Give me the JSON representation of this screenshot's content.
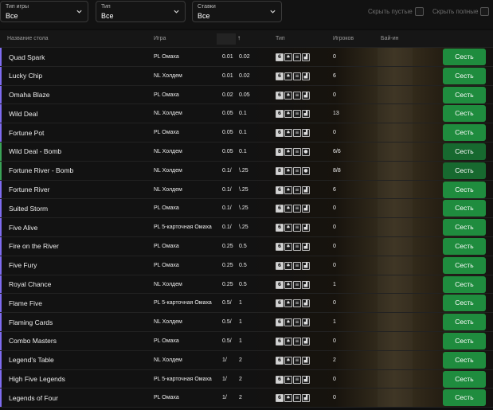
{
  "filters": {
    "game_type": {
      "label": "Тип игры",
      "value": "Все"
    },
    "type": {
      "label": "Тип",
      "value": "Все"
    },
    "stakes": {
      "label": "Ставки",
      "value": "Все"
    },
    "hide_empty": "Скрыть пустые",
    "hide_full": "Скрыть полные"
  },
  "columns": {
    "name": "Название стола",
    "game": "Игра",
    "sort_icon": "↑",
    "type": "Тип",
    "players": "Игроков",
    "buyin": "Бай-ин"
  },
  "colors": {
    "accent_purple": "#7f6cf0",
    "accent_green": "#3aa357",
    "sit_button": "#1f8c3e",
    "sit_button_dark": "#17692f"
  },
  "sit_label": "Сесть",
  "rows": [
    {
      "name": "Quad Spark",
      "game": "PL Омаха",
      "blind1": "0.01",
      "blind2": "0.02",
      "players": "0",
      "accent": "purple",
      "icon4": "chart"
    },
    {
      "name": "Lucky Chip",
      "game": "NL Холдем",
      "blind1": "0.01",
      "blind2": "0.02",
      "players": "6",
      "accent": "purple",
      "icon4": "chart"
    },
    {
      "name": "Omaha Blaze",
      "game": "PL Омаха",
      "blind1": "0.02",
      "blind2": "0.05",
      "players": "0",
      "accent": "purple",
      "icon4": "chart"
    },
    {
      "name": "Wild Deal",
      "game": "NL Холдем",
      "blind1": "0.05",
      "blind2": "0.1",
      "players": "13",
      "accent": "purple",
      "icon4": "chart"
    },
    {
      "name": "Fortune Pot",
      "game": "PL Омаха",
      "blind1": "0.05",
      "blind2": "0.1",
      "players": "0",
      "accent": "purple",
      "icon4": "chart"
    },
    {
      "name": "Wild Deal - Bomb",
      "game": "NL Холдем",
      "blind1": "0.05",
      "blind2": "0.1",
      "players": "6/6",
      "accent": "green",
      "icon4": "bomb"
    },
    {
      "name": "Fortune River - Bomb",
      "game": "NL Холдем",
      "blind1": "0.1/",
      "blind2": "\\.25",
      "players": "8/8",
      "accent": "green",
      "icon4": "bomb"
    },
    {
      "name": "Fortune River",
      "game": "NL Холдем",
      "blind1": "0.1/",
      "blind2": "\\.25",
      "players": "6",
      "accent": "purple",
      "icon4": "chart"
    },
    {
      "name": "Suited Storm",
      "game": "PL Омаха",
      "blind1": "0.1/",
      "blind2": "\\.25",
      "players": "0",
      "accent": "purple",
      "icon4": "chart"
    },
    {
      "name": "Five Alive",
      "game": "PL 5-карточная Омаха",
      "blind1": "0.1/",
      "blind2": "\\.25",
      "players": "0",
      "accent": "purple",
      "icon4": "chart"
    },
    {
      "name": "Fire on the River",
      "game": "PL Омаха",
      "blind1": "0.25",
      "blind2": "0.5",
      "players": "0",
      "accent": "purple",
      "icon4": "chart"
    },
    {
      "name": "Five  Fury",
      "game": "PL Омаха",
      "blind1": "0.25",
      "blind2": "0.5",
      "players": "0",
      "accent": "purple",
      "icon4": "chart"
    },
    {
      "name": "Royal Chance",
      "game": "NL Холдем",
      "blind1": "0.25",
      "blind2": "0.5",
      "players": "1",
      "accent": "purple",
      "icon4": "chart"
    },
    {
      "name": "Flame  Five",
      "game": "PL 5-карточная Омаха",
      "blind1": "0.5/",
      "blind2": "1",
      "players": "0",
      "accent": "purple",
      "icon4": "chart"
    },
    {
      "name": "Flaming Cards",
      "game": "NL Холдем",
      "blind1": "0.5/",
      "blind2": "1",
      "players": "1",
      "accent": "purple",
      "icon4": "chart"
    },
    {
      "name": "Combo Masters",
      "game": "PL Омаха",
      "blind1": "0.5/",
      "blind2": "1",
      "players": "0",
      "accent": "purple",
      "icon4": "chart"
    },
    {
      "name": "Legend's Table",
      "game": "NL Холдем",
      "blind1": "1/",
      "blind2": "2",
      "players": "2",
      "accent": "purple",
      "icon4": "chart"
    },
    {
      "name": "High  Five Legends",
      "game": "PL 5-карточная Омаха",
      "blind1": "1/",
      "blind2": "2",
      "players": "0",
      "accent": "purple",
      "icon4": "chart"
    },
    {
      "name": "Legends of Four",
      "game": "PL Омаха",
      "blind1": "1/",
      "blind2": "2",
      "players": "0",
      "accent": "purple",
      "icon4": "chart"
    }
  ]
}
